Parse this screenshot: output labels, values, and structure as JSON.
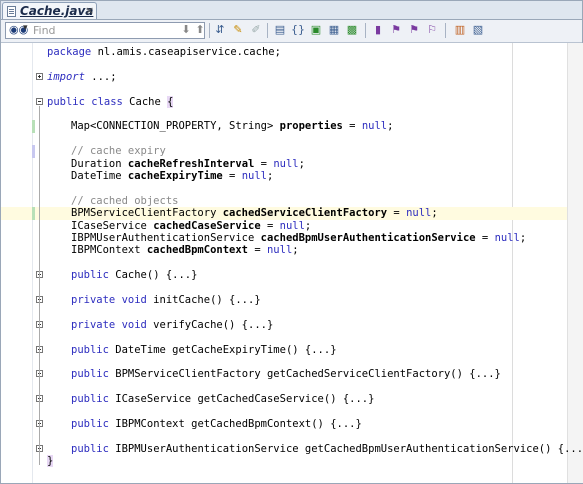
{
  "tab": {
    "title": "Cache.java",
    "close": "×"
  },
  "toolbar": {
    "find_placeholder": "Find",
    "icons": [
      "binoculars-icon",
      "arrow-down-icon",
      "arrow-up-icon",
      "toggle-hierarchy-icon",
      "highlight-icon",
      "clear-highlight-icon",
      "find-usages-icon",
      "brace-icon",
      "go-to-class-icon",
      "go-to-declaration-icon",
      "run-icon",
      "bookmark-icon",
      "next-bookmark-icon",
      "prev-bookmark-icon",
      "clear-bookmark-icon",
      "comment-icon",
      "block-icon"
    ]
  },
  "code": [
    {
      "parts": [
        [
          "kw",
          "package"
        ],
        [
          "",
          " nl.amis.caseapiservice.cache;"
        ]
      ]
    },
    {
      "parts": []
    },
    {
      "fold": "plus",
      "parts": [
        [
          "kw it",
          "import"
        ],
        [
          "",
          " ...;"
        ]
      ]
    },
    {
      "parts": []
    },
    {
      "fold": "minus",
      "parts": [
        [
          "kw",
          "public class"
        ],
        [
          "",
          " Cache "
        ],
        [
          "bracehl",
          "{"
        ]
      ]
    },
    {
      "parts": []
    },
    {
      "indent": 1,
      "parts": [
        [
          "",
          "Map<CONNECTION_PROPERTY, String> "
        ],
        [
          "b",
          "properties"
        ],
        [
          "",
          " = "
        ],
        [
          "kw",
          "null"
        ],
        [
          "",
          ";"
        ]
      ]
    },
    {
      "parts": []
    },
    {
      "indent": 1,
      "parts": [
        [
          "cm",
          "// cache expiry"
        ]
      ]
    },
    {
      "indent": 1,
      "parts": [
        [
          "",
          "Duration "
        ],
        [
          "b",
          "cacheRefreshInterval"
        ],
        [
          "",
          " = "
        ],
        [
          "kw",
          "null"
        ],
        [
          "",
          ";"
        ]
      ]
    },
    {
      "indent": 1,
      "parts": [
        [
          "",
          "DateTime "
        ],
        [
          "b",
          "cacheExpiryTime"
        ],
        [
          "",
          " = "
        ],
        [
          "kw",
          "null"
        ],
        [
          "",
          ";"
        ]
      ]
    },
    {
      "parts": []
    },
    {
      "indent": 1,
      "parts": [
        [
          "cm",
          "// cached objects"
        ]
      ]
    },
    {
      "indent": 1,
      "hl": true,
      "parts": [
        [
          "",
          "BPMServiceClientFactory "
        ],
        [
          "b",
          "cachedServiceClientFactory"
        ],
        [
          "",
          " = "
        ],
        [
          "kw",
          "null"
        ],
        [
          "",
          ";"
        ]
      ]
    },
    {
      "indent": 1,
      "parts": [
        [
          "",
          "ICaseService "
        ],
        [
          "b",
          "cachedCaseService"
        ],
        [
          "",
          " = "
        ],
        [
          "kw",
          "null"
        ],
        [
          "",
          ";"
        ]
      ]
    },
    {
      "indent": 1,
      "parts": [
        [
          "",
          "IBPMUserAuthenticationService "
        ],
        [
          "b",
          "cachedBpmUserAuthenticationService"
        ],
        [
          "",
          " = "
        ],
        [
          "kw",
          "null"
        ],
        [
          "",
          ";"
        ]
      ]
    },
    {
      "indent": 1,
      "parts": [
        [
          "",
          "IBPMContext "
        ],
        [
          "b",
          "cachedBpmContext"
        ],
        [
          "",
          " = "
        ],
        [
          "kw",
          "null"
        ],
        [
          "",
          ";"
        ]
      ]
    },
    {
      "parts": []
    },
    {
      "indent": 1,
      "fold": "plus",
      "parts": [
        [
          "kw",
          "public"
        ],
        [
          "",
          " Cache() {...}"
        ]
      ]
    },
    {
      "parts": []
    },
    {
      "indent": 1,
      "fold": "plus",
      "parts": [
        [
          "kw",
          "private void"
        ],
        [
          "",
          " initCache() {...}"
        ]
      ]
    },
    {
      "parts": []
    },
    {
      "indent": 1,
      "fold": "plus",
      "parts": [
        [
          "kw",
          "private void"
        ],
        [
          "",
          " verifyCache() {...}"
        ]
      ]
    },
    {
      "parts": []
    },
    {
      "indent": 1,
      "fold": "plus",
      "parts": [
        [
          "kw",
          "public"
        ],
        [
          "",
          " DateTime getCacheExpiryTime() {...}"
        ]
      ]
    },
    {
      "parts": []
    },
    {
      "indent": 1,
      "fold": "plus",
      "parts": [
        [
          "kw",
          "public"
        ],
        [
          "",
          " BPMServiceClientFactory getCachedServiceClientFactory() {...}"
        ]
      ]
    },
    {
      "parts": []
    },
    {
      "indent": 1,
      "fold": "plus",
      "parts": [
        [
          "kw",
          "public"
        ],
        [
          "",
          " ICaseService getCachedCaseService() {...}"
        ]
      ]
    },
    {
      "parts": []
    },
    {
      "indent": 1,
      "fold": "plus",
      "parts": [
        [
          "kw",
          "public"
        ],
        [
          "",
          " IBPMContext getCachedBpmContext() {...}"
        ]
      ]
    },
    {
      "parts": []
    },
    {
      "indent": 1,
      "fold": "plus",
      "parts": [
        [
          "kw",
          "public"
        ],
        [
          "",
          " IBPMUserAuthenticationService getCachedBpmUserAuthenticationService() {...}"
        ]
      ]
    },
    {
      "parts": [
        [
          "bracehl",
          "}"
        ]
      ]
    }
  ]
}
